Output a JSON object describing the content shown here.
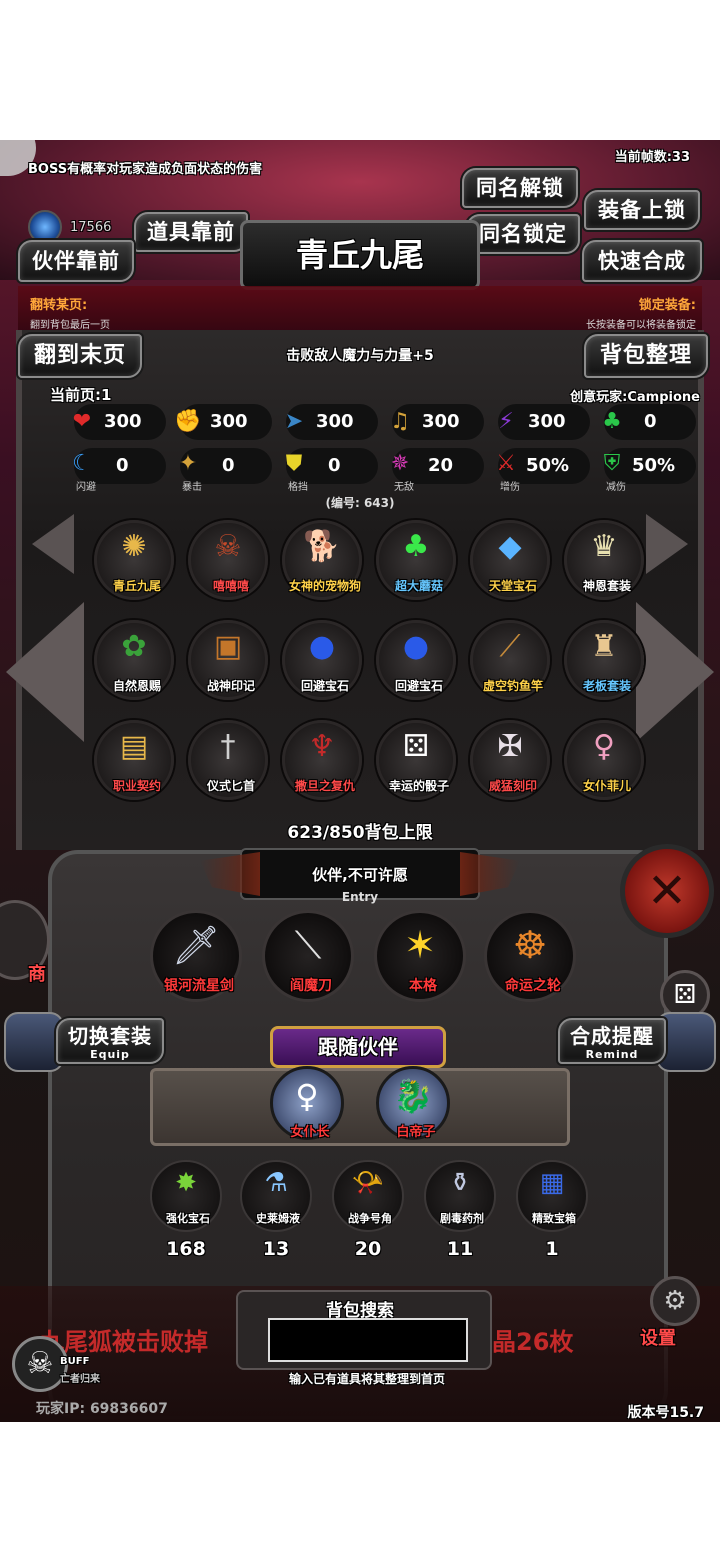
{
  "top": {
    "boss_notice": "BOSS有概率对玩家造成负面状态的伤害",
    "fps": "当前帧数:33",
    "gem_count": "17566"
  },
  "buttons": {
    "same_name_unlock": "同名解锁",
    "equip_unlock": "装备上锁",
    "item_front": "道具靠前",
    "same_name_lock": "同名锁定",
    "partner_front": "伙伴靠前",
    "quick_merge": "快速合成",
    "to_last_page": "翻到末页",
    "bag_sort": "背包整理",
    "switch_set": "切换套装",
    "switch_set_sub": "Equip",
    "merge_remind": "合成提醒",
    "merge_remind_sub": "Remind"
  },
  "header": {
    "title": "青丘九尾"
  },
  "info": {
    "flip_label": "翻转某页:",
    "flip_desc": "翻到背包最后一页",
    "lock_label": "锁定装备:",
    "lock_desc": "长按装备可以将装备锁定",
    "effect": "击败敌人魔力与力量+5",
    "page": "当前页:1",
    "creator": "创意玩家:Campione",
    "id": "(编号: 643)"
  },
  "stats": {
    "row1": [
      {
        "icon": "heart-icon",
        "glyph": "❤",
        "color": "#e02a2a",
        "value": "300"
      },
      {
        "icon": "strength-icon",
        "glyph": "✊",
        "color": "#e8c72a",
        "value": "300"
      },
      {
        "icon": "speed-icon",
        "glyph": "➤",
        "color": "#3a86c7",
        "value": "300"
      },
      {
        "icon": "lute-icon",
        "glyph": "♫",
        "color": "#d4a23a",
        "value": "300"
      },
      {
        "icon": "magic-icon",
        "glyph": "⚡",
        "color": "#8a3ad4",
        "value": "300"
      },
      {
        "icon": "clover-icon",
        "glyph": "♣",
        "color": "#2ac74a",
        "value": "0"
      }
    ],
    "row2": [
      {
        "icon": "dodge-icon",
        "glyph": "☾",
        "color": "#3aa2ff",
        "value": "0",
        "label": "闪避"
      },
      {
        "icon": "crit-icon",
        "glyph": "✦",
        "color": "#d4a23a",
        "value": "0",
        "label": "暴击"
      },
      {
        "icon": "block-icon",
        "glyph": "⛊",
        "color": "#e8d42a",
        "value": "0",
        "label": "格挡"
      },
      {
        "icon": "invincible-icon",
        "glyph": "✵",
        "color": "#d43ab4",
        "value": "20",
        "label": "无敌"
      },
      {
        "icon": "damage-up-icon",
        "glyph": "⚔",
        "color": "#e02a2a",
        "value": "50%",
        "label": "增伤"
      },
      {
        "icon": "damage-down-icon",
        "glyph": "⛨",
        "color": "#2ac74a",
        "value": "50%",
        "label": "减伤"
      }
    ]
  },
  "items": [
    {
      "name": "青丘九尾",
      "glyph": "✺",
      "gcolor": "#e8b84a",
      "tone": "gold"
    },
    {
      "name": "嘻嘻嘻",
      "glyph": "☠",
      "gcolor": "#c44a2a",
      "tone": "red"
    },
    {
      "name": "女神的宠物狗",
      "glyph": "🐕",
      "gcolor": "#e8a04a",
      "tone": "gold"
    },
    {
      "name": "超大蘑菇",
      "glyph": "♣",
      "gcolor": "#3ae84a",
      "tone": "blue"
    },
    {
      "name": "天堂宝石",
      "glyph": "◆",
      "gcolor": "#5ab4ff",
      "tone": "gold"
    },
    {
      "name": "神恩套装",
      "glyph": "♛",
      "gcolor": "#e8e0b0",
      "tone": "white"
    },
    {
      "name": "自然恩赐",
      "glyph": "✿",
      "gcolor": "#3aa23a",
      "tone": "white"
    },
    {
      "name": "战神印记",
      "glyph": "▣",
      "gcolor": "#c4762a",
      "tone": "white"
    },
    {
      "name": "回避宝石",
      "glyph": "●",
      "gcolor": "#2a5ae8",
      "tone": "white"
    },
    {
      "name": "回避宝石",
      "glyph": "●",
      "gcolor": "#2a5ae8",
      "tone": "white"
    },
    {
      "name": "虚空钓鱼竿",
      "glyph": "⟋",
      "gcolor": "#c48a3a",
      "tone": "gold"
    },
    {
      "name": "老板套装",
      "glyph": "♜",
      "gcolor": "#e8c790",
      "tone": "blue"
    },
    {
      "name": "职业契约",
      "glyph": "▤",
      "gcolor": "#e8b84a",
      "tone": "red"
    },
    {
      "name": "仪式匕首",
      "glyph": "†",
      "gcolor": "#d0d0d0",
      "tone": "white"
    },
    {
      "name": "撒旦之复仇",
      "glyph": "♆",
      "gcolor": "#c42a2a",
      "tone": "red"
    },
    {
      "name": "幸运的骰子",
      "glyph": "⚄",
      "gcolor": "#ffffff",
      "tone": "white"
    },
    {
      "name": "威猛刻印",
      "glyph": "✠",
      "gcolor": "#e8e0e8",
      "tone": "red"
    },
    {
      "name": "女仆菲儿",
      "glyph": "♀",
      "gcolor": "#f0a0c0",
      "tone": "gold"
    }
  ],
  "bag_limit": "623/850背包上限",
  "wish": {
    "text": "伙伴,不可许愿",
    "entry": "Entry"
  },
  "equipped": [
    {
      "name": "银河流星剑",
      "glyph": "🗡",
      "gcolor": "#d0d8e8"
    },
    {
      "name": "阎魔刀",
      "glyph": "⟍",
      "gcolor": "#e0e0e0"
    },
    {
      "name": "本格",
      "glyph": "✶",
      "gcolor": "#ffd42a"
    },
    {
      "name": "命运之轮",
      "glyph": "☸",
      "gcolor": "#e8862a"
    }
  ],
  "follow": {
    "title": "跟随伙伴",
    "partners": [
      {
        "name": "女仆长",
        "glyph": "♀"
      },
      {
        "name": "白帝子",
        "glyph": "🐉"
      }
    ]
  },
  "materials": [
    {
      "name": "强化宝石",
      "glyph": "✸",
      "gcolor": "#7ad43a",
      "count": "168"
    },
    {
      "name": "史莱姆液",
      "glyph": "⚗",
      "gcolor": "#8ac7ff",
      "count": "13"
    },
    {
      "name": "战争号角",
      "glyph": "📯",
      "gcolor": "#c0a0e8",
      "count": "20"
    },
    {
      "name": "剧毒药剂",
      "glyph": "⚱",
      "gcolor": "#c0c8e0",
      "count": "11"
    },
    {
      "name": "精致宝箱",
      "glyph": "▦",
      "gcolor": "#3a6ae8",
      "count": "1"
    }
  ],
  "search": {
    "title": "背包搜索",
    "hint": "输入已有道具将其整理到首页"
  },
  "footer": {
    "marquee_left": "九尾狐被击败掉",
    "marquee_right": "晶26枚",
    "settings": "设置",
    "buff": "BUFF",
    "buff_sub": "亡者归来",
    "ip": "玩家IP: 69836607",
    "version": "版本号15.7",
    "shop_partial": "商"
  }
}
